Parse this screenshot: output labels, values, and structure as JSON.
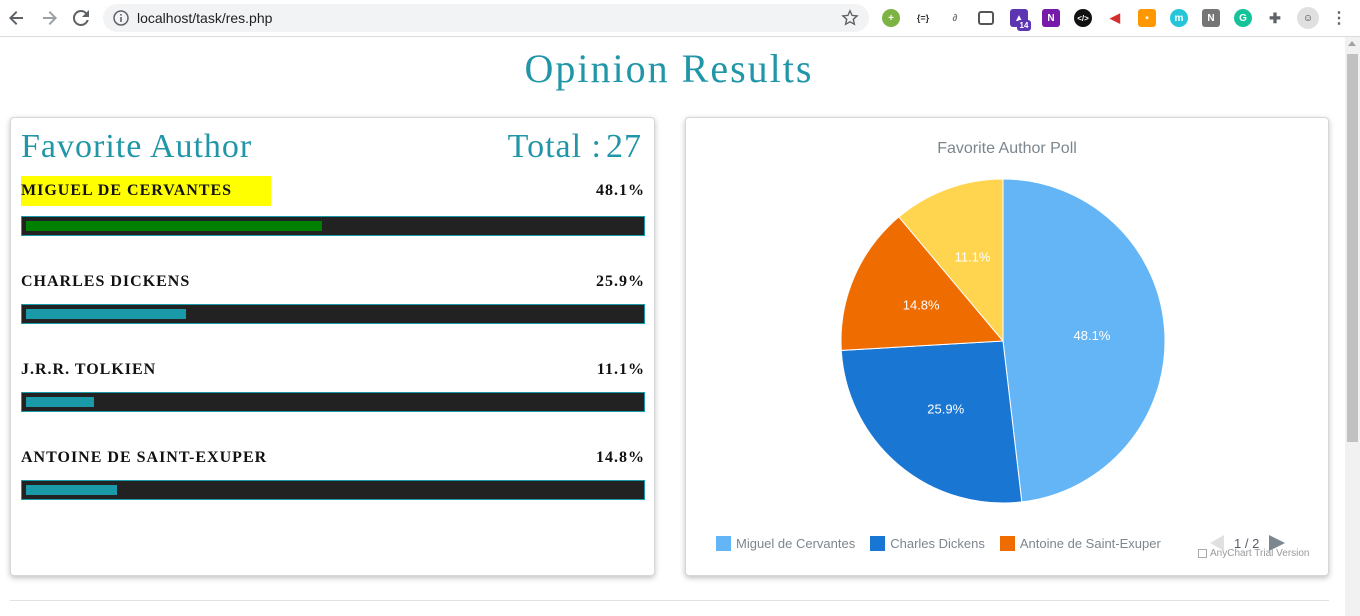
{
  "browser": {
    "url": "localhost/task/res.php",
    "notification_count": "14"
  },
  "page": {
    "title": "Opinion Results"
  },
  "poll": {
    "title": "Favorite Author",
    "total_label": "Total :",
    "total_value": "27",
    "items": [
      {
        "name": "MIGUEL DE CERVANTES",
        "percent": "48.1%",
        "fraction": 0.481,
        "color": "#008000",
        "highlight": true
      },
      {
        "name": "CHARLES DICKENS",
        "percent": "25.9%",
        "fraction": 0.259,
        "color": "#1a9aa8",
        "highlight": false
      },
      {
        "name": "J.R.R. TOLKIEN",
        "percent": "11.1%",
        "fraction": 0.111,
        "color": "#1a9aa8",
        "highlight": false
      },
      {
        "name": "ANTOINE DE SAINT-EXUPER",
        "percent": "14.8%",
        "fraction": 0.148,
        "color": "#1a9aa8",
        "highlight": false
      }
    ]
  },
  "chart_data": {
    "type": "pie",
    "title": "Favorite Author Poll",
    "slices": [
      {
        "label": "Miguel de Cervantes",
        "value": 48.1,
        "display": "48.1%",
        "color": "#64b5f6"
      },
      {
        "label": "Charles Dickens",
        "value": 25.9,
        "display": "25.9%",
        "color": "#1976d2"
      },
      {
        "label": "Antoine de Saint-Exuper",
        "value": 14.8,
        "display": "14.8%",
        "color": "#ef6c00"
      },
      {
        "label": "J.R.R. Tolkien",
        "value": 11.1,
        "display": "11.1%",
        "color": "#ffd54f"
      }
    ],
    "legend": [
      "Miguel de Cervantes",
      "Charles Dickens",
      "Antoine de Saint-Exuper"
    ],
    "legend_placement": "bottom",
    "pager": "1 / 2",
    "watermark": "AnyChart Trial Version"
  }
}
